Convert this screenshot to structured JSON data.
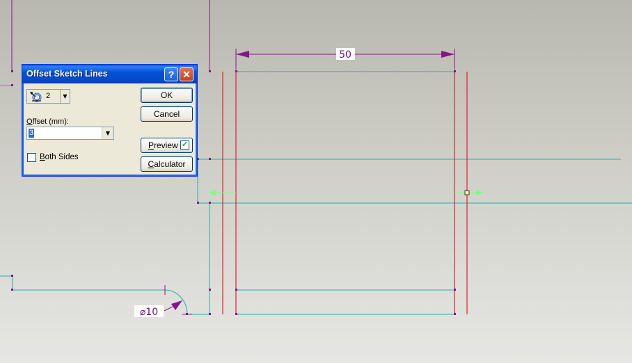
{
  "dialog": {
    "title": "Offset Sketch Lines",
    "help_button": "?",
    "close_button": "✕",
    "count_value": "2",
    "offset_label_prefix": "O",
    "offset_label_rest": "ffset (mm):",
    "offset_value": "3",
    "both_sides_prefix": "B",
    "both_sides_rest": "oth Sides",
    "both_sides_checked": false,
    "ok_label": "OK",
    "cancel_label": "Cancel",
    "preview_prefix": "P",
    "preview_rest": "review",
    "preview_checked": true,
    "calculator_prefix": "C",
    "calculator_rest": "alculator"
  },
  "sketch": {
    "width_dimension": "50",
    "diameter_dimension": "⌀10",
    "colors": {
      "sketch_line": "#20b2aa",
      "offset_preview": "#e0202a",
      "dimension": "#8a128e",
      "direction_arrow": "#7cff7c"
    }
  }
}
